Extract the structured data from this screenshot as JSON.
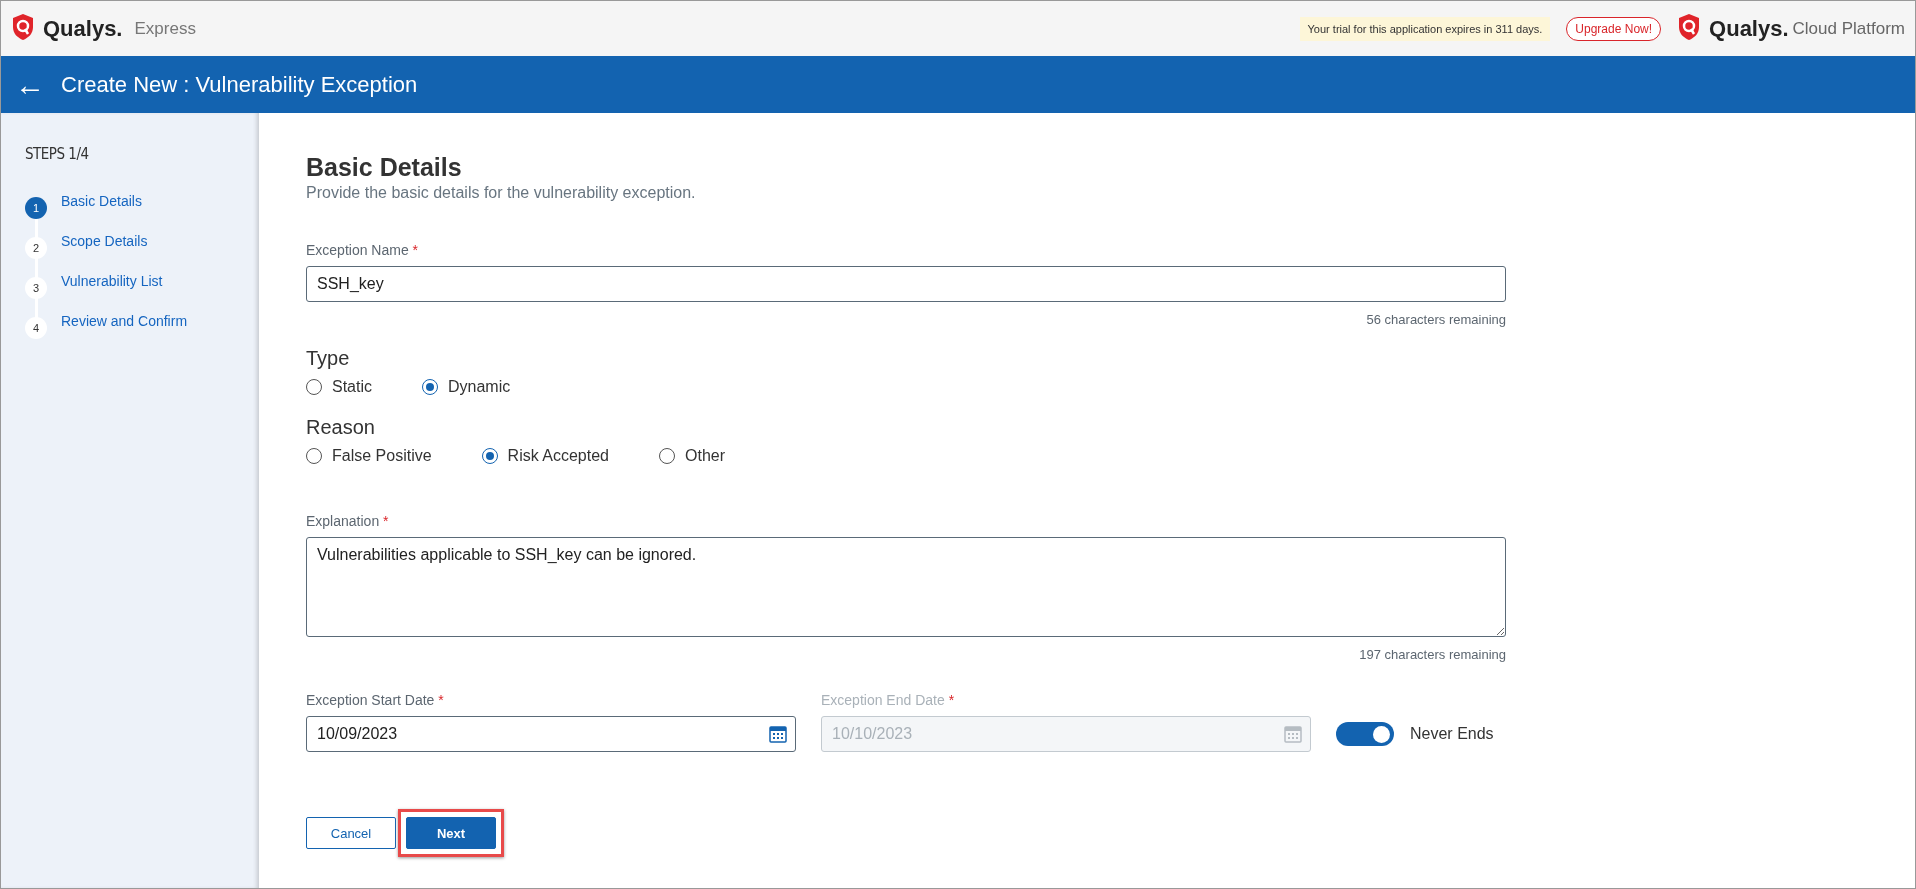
{
  "topbar": {
    "brand": "Qualys.",
    "product": "Express",
    "trial_notice": "Your trial for this application expires in 311 days.",
    "upgrade_button": "Upgrade Now!",
    "platform_brand": "Qualys.",
    "platform_name": "Cloud Platform"
  },
  "page_header": {
    "back": "←",
    "title": "Create New : Vulnerability Exception"
  },
  "steps": {
    "heading": "STEPS 1/4",
    "items": [
      {
        "number": "1",
        "label": "Basic Details",
        "selected": true
      },
      {
        "number": "2",
        "label": "Scope Details",
        "selected": false
      },
      {
        "number": "3",
        "label": "Vulnerability List",
        "selected": false
      },
      {
        "number": "4",
        "label": "Review and Confirm",
        "selected": false
      }
    ]
  },
  "section": {
    "title": "Basic Details",
    "subtitle": "Provide the basic details for the vulnerability exception."
  },
  "exception_name": {
    "label": "Exception Name",
    "required_mark": "*",
    "value": "SSH_key",
    "counter": "56 characters remaining"
  },
  "type": {
    "heading": "Type",
    "options": [
      {
        "label": "Static",
        "selected": false
      },
      {
        "label": "Dynamic",
        "selected": true
      }
    ]
  },
  "reason": {
    "heading": "Reason",
    "options": [
      {
        "label": "False Positive",
        "selected": false
      },
      {
        "label": "Risk Accepted",
        "selected": true
      },
      {
        "label": "Other",
        "selected": false
      }
    ]
  },
  "explanation": {
    "label": "Explanation",
    "required_mark": "*",
    "value": "Vulnerabilities applicable to SSH_key can be ignored.",
    "counter": "197 characters remaining"
  },
  "dates": [
    {
      "label": "Exception Start Date",
      "required_mark": "*",
      "value": "10/09/2023",
      "disabled": false
    },
    {
      "label": "Exception End Date",
      "required_mark": "*",
      "value": "10/10/2023",
      "disabled": true
    }
  ],
  "never_ends": {
    "label": "Never Ends",
    "on": true
  },
  "buttons": [
    {
      "label": "Cancel",
      "kind": "secondary",
      "highlighted": false
    },
    {
      "label": "Next",
      "kind": "primary",
      "highlighted": true
    }
  ]
}
